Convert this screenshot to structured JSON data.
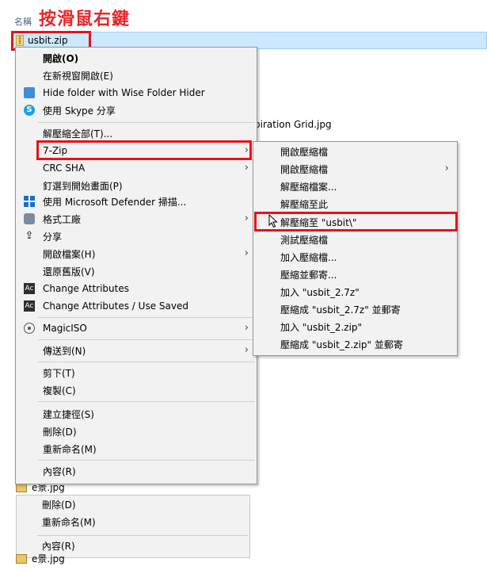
{
  "header": {
    "column_name": "名稱",
    "annotation": "按滑鼠右鍵"
  },
  "selected_file": {
    "name": "usbit.zip"
  },
  "background_files": [
    {
      "name": "piration Grid.jpg"
    },
    {
      "name": "e景.jpg"
    },
    {
      "name": "e景.jpg"
    }
  ],
  "context_menu": {
    "items": [
      {
        "label": "開啟(O)",
        "bold": true
      },
      {
        "label": "在新視窗開啟(E)"
      },
      {
        "label": "Hide folder with Wise Folder Hider",
        "icon": "wise-folder-hider-icon"
      },
      {
        "label": "使用 Skype 分享",
        "icon": "skype-icon"
      },
      {
        "label": "解壓縮全部(T)..."
      },
      {
        "label": "7-Zip"
      },
      {
        "label": "CRC SHA"
      },
      {
        "label": "釘選到開始畫面(P)"
      },
      {
        "label": "使用 Microsoft Defender 掃描...",
        "icon": "defender-shield-icon"
      },
      {
        "label": "格式工廠",
        "icon": "format-factory-icon"
      },
      {
        "label": "分享",
        "icon": "share-icon"
      },
      {
        "label": "開啟檔案(H)"
      },
      {
        "label": "還原舊版(V)"
      },
      {
        "label": "Change Attributes",
        "icon": "change-attributes-icon"
      },
      {
        "label": "Change Attributes / Use Saved",
        "icon": "change-attributes-icon"
      },
      {
        "label": "MagicISO",
        "icon": "magiciso-icon"
      },
      {
        "label": "傳送到(N)"
      },
      {
        "label": "剪下(T)"
      },
      {
        "label": "複製(C)"
      },
      {
        "label": "建立捷徑(S)"
      },
      {
        "label": "刪除(D)"
      },
      {
        "label": "重新命名(M)"
      },
      {
        "label": "內容(R)"
      }
    ]
  },
  "submenu_7zip": {
    "items": [
      {
        "label": "開啟壓縮檔"
      },
      {
        "label": "開啟壓縮檔"
      },
      {
        "label": "解壓縮檔案..."
      },
      {
        "label": "解壓縮至此"
      },
      {
        "label": "解壓縮至 \"usbit\\\""
      },
      {
        "label": "測試壓縮檔"
      },
      {
        "label": "加入壓縮檔..."
      },
      {
        "label": "壓縮並郵寄..."
      },
      {
        "label": "加入 \"usbit_2.7z\""
      },
      {
        "label": "壓縮成 \"usbit_2.7z\" 並郵寄"
      },
      {
        "label": "加入 \"usbit_2.zip\""
      },
      {
        "label": "壓縮成 \"usbit_2.zip\" 並郵寄"
      }
    ]
  },
  "partial_menu": {
    "items": [
      {
        "label": "刪除(D)"
      },
      {
        "label": "重新命名(M)"
      },
      {
        "label": "內容(R)"
      }
    ]
  },
  "colors": {
    "highlight_border": "#e8121a",
    "annotation": "#e8262a",
    "selection": "#cce8ff",
    "menu_bg": "#f2f2f2"
  }
}
